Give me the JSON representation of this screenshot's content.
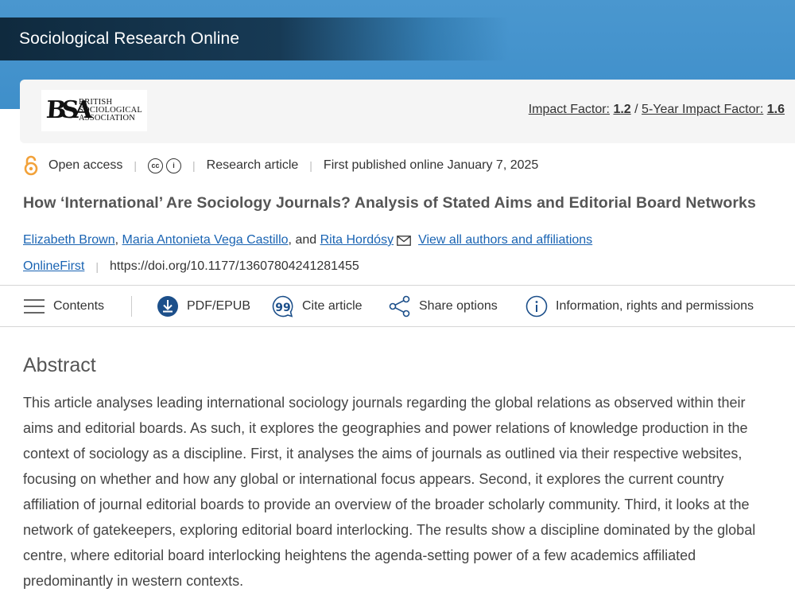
{
  "header": {
    "journal_title": "Sociological Research Online",
    "logo_mark": "BSA",
    "logo_text_line1": "BRITISH",
    "logo_text_line2": "SOCIOLOGICAL",
    "logo_text_line3": "ASSOCIATION",
    "impact_label": "Impact Factor:",
    "impact_value": "1.2",
    "impact_sep": "/",
    "five_year_label": "5-Year Impact Factor:",
    "five_year_value": "1.6"
  },
  "meta": {
    "open_access": "Open access",
    "cc_label": "cc",
    "by_label": "i",
    "article_type": "Research article",
    "published": "First published online January 7, 2025"
  },
  "article": {
    "title": "How ‘International’ Are Sociology Journals? Analysis of Stated Aims and Editorial Board Networks",
    "authors": [
      {
        "name": "Elizabeth Brown"
      },
      {
        "name": "Maria Antonieta Vega Castillo"
      },
      {
        "name": "Rita Hordósy"
      }
    ],
    "author_sep1": ",",
    "author_sep2": ", and",
    "view_all_link": "View all authors and affiliations",
    "online_first": "OnlineFirst",
    "doi": "https://doi.org/10.1177/13607804241281455"
  },
  "toolbar": {
    "contents": "Contents",
    "pdf": "PDF/EPUB",
    "cite": "Cite article",
    "share": "Share options",
    "info": "Information, rights and permissions"
  },
  "abstract": {
    "heading": "Abstract",
    "text": "This article analyses leading international sociology journals regarding the global relations as observed within their aims and editorial boards. As such, it explores the geographies and power relations of knowledge production in the context of sociology as a discipline. First, it analyses the aims of journals as outlined via their respective websites, focusing on whether and how any global or international focus appears. Second, it explores the current country affiliation of journal editorial boards to provide an overview of the broader scholarly community. Third, it looks at the network of gatekeepers, exploring editorial board interlocking. The results show a discipline dominated by the global centre, where editorial board interlocking heightens the agenda-setting power of a few academics affiliated predominantly in western contexts."
  },
  "colors": {
    "header_blue": "#4a97cf",
    "header_dark": "#0f2a3e",
    "link_blue": "#1a64b3",
    "open_access_orange": "#f2a23a"
  }
}
